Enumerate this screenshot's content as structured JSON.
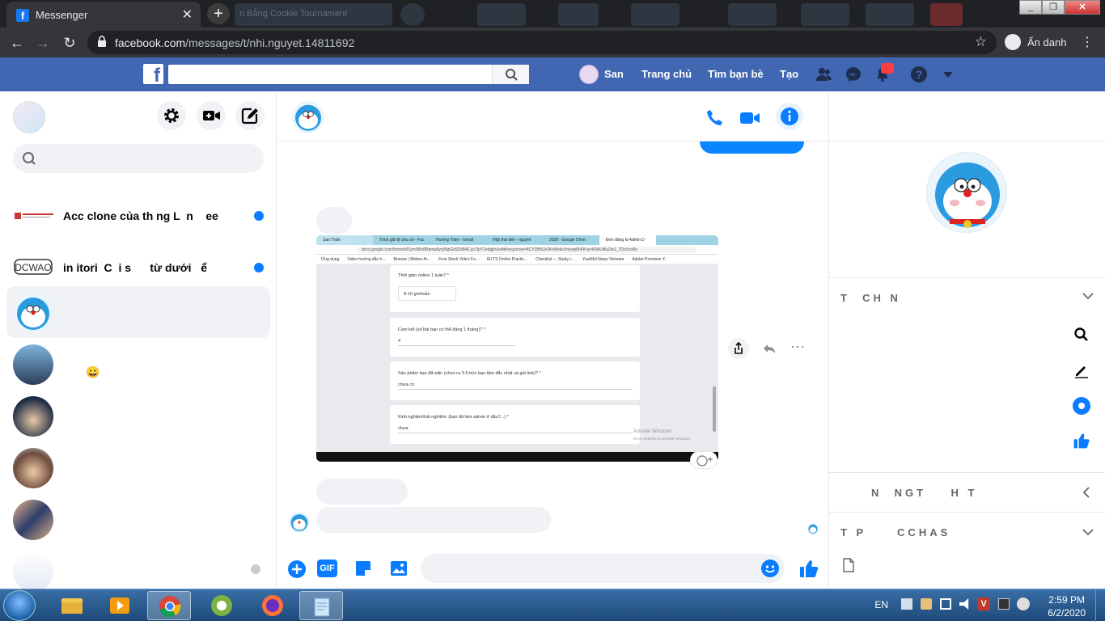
{
  "browser": {
    "tab_title": "Messenger",
    "ghost_tab_title": "n Bằng Cookie Tournament",
    "url_domain": "facebook.com",
    "url_path": "/messages/t/nhi.nguyet.14811692",
    "profile_label": "Ẩn danh"
  },
  "facebook_bar": {
    "logo": "f",
    "user_name": "San",
    "nav_home": "Trang chủ",
    "nav_find_friends": "Tìm bạn bè",
    "nav_create": "Tạo"
  },
  "conversations": [
    {
      "name": "Acc clone của th ng L  n    ee",
      "unread": true
    },
    {
      "name": "in itori  C  i s      từ dưới   ể",
      "unread": true
    },
    {
      "name": "",
      "unread": false,
      "selected": true
    },
    {
      "name": "😀",
      "unread": false
    },
    {
      "name": "",
      "unread": false
    },
    {
      "name": "",
      "unread": false
    },
    {
      "name": "",
      "unread": false
    },
    {
      "name": "",
      "unread": false
    }
  ],
  "shared_screenshot": {
    "tabs": [
      "San Thân",
      "Trình giữ ổi chia sẻ - Fac",
      "Hương Trăm - Gmail",
      "Hộp thư đến - nguyet",
      "2020 - Google Drive",
      "Đơn đăng kí Admin D"
    ],
    "url": "docs.google.com/forms/d/1ym0t0x8Rqmu8yrpNgiGdS0d8ACyu7lpY2edgjbv/edit#response=ACYDBNJx34cWeksXmyep8hFKoyvK8ALMiy2te1_7DoVzsNs",
    "bookmarks": [
      "Ứng dụng",
      "Video hướng dẫn h...",
      "Browse | Motion Ar...",
      "Free Stock Video Fo...",
      "IELTS Online Practic...",
      "Checklist — Study t...",
      "Youthful News Vietnam",
      "Adobe Premiere Y..."
    ],
    "q1_label": "Thời gian online 1 tuần? *",
    "q1_value": "8-10 giờ/tuần",
    "q2_label": "Cam kết (số bài bạn có thể đăng 1 tháng)? *",
    "q2_value": "4",
    "q3_label": "Sản phẩm bạn đã edit: (chọn ra 3-5 bức bạn tâm đắc nhất và gửi link)? *",
    "q3_value": "chưa có",
    "q4_label": "Kinh nghiệm/trải nghiệm: (bạn đã làm admin ở đâu?...) *",
    "q4_value": "chưa",
    "watermark_title": "Activate Windows",
    "watermark_sub": "Go to Settings to activate Windows."
  },
  "composer": {
    "gif_label": "GIF",
    "placeholder": ""
  },
  "right_panel": {
    "section_customize": "T  CH N",
    "section_privacy": "N  NGT    H T",
    "section_shared": "T P     CCHAS"
  },
  "taskbar": {
    "language": "EN",
    "time": "2:59 PM",
    "date": "6/2/2020"
  },
  "colors": {
    "messenger_blue": "#0a7cff",
    "facebook_blue": "#4267b2",
    "chrome_dark": "#202124"
  }
}
